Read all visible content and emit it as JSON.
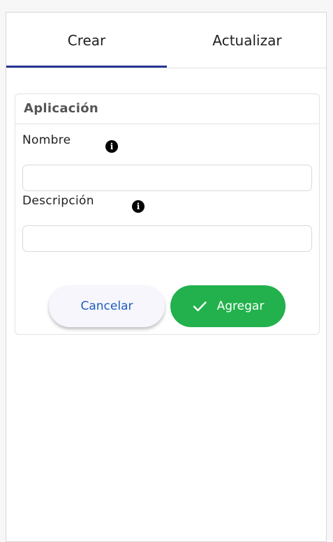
{
  "tabs": [
    {
      "label": "Crear",
      "active": true
    },
    {
      "label": "Actualizar",
      "active": false
    }
  ],
  "card": {
    "title": "Aplicación"
  },
  "fields": {
    "name": {
      "label": "Nombre",
      "value": "",
      "placeholder": ""
    },
    "description": {
      "label": "Descripción",
      "value": "",
      "placeholder": ""
    }
  },
  "actions": {
    "cancel_label": "Cancelar",
    "add_label": "Agregar"
  },
  "colors": {
    "tab_indicator": "#283593",
    "primary_button": "#22b14c",
    "cancel_text": "#1f5cc0"
  },
  "icons": {
    "info": "info-icon",
    "check": "check-icon"
  }
}
